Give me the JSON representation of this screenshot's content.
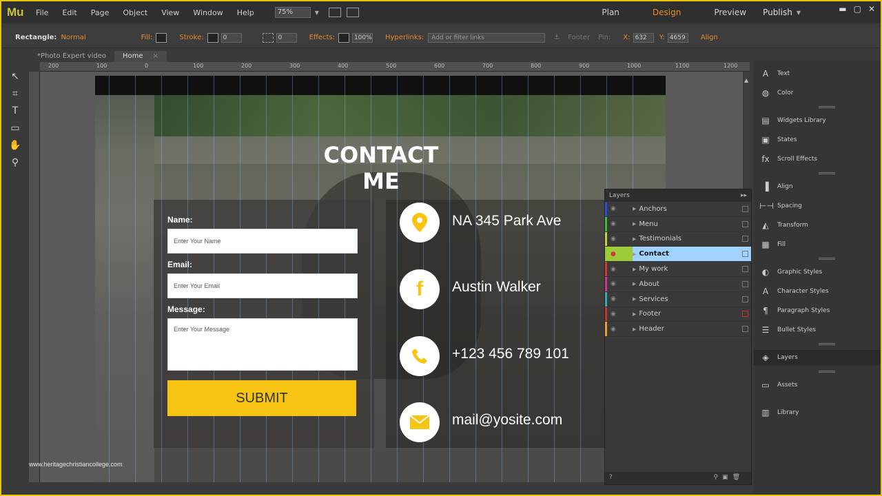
{
  "app": {
    "logo": "Mu",
    "menu": [
      "File",
      "Edit",
      "Page",
      "Object",
      "View",
      "Window",
      "Help"
    ],
    "zoom": "75%",
    "modes": [
      "Plan",
      "Design",
      "Preview"
    ],
    "active_mode": "Design",
    "publish": "Publish"
  },
  "control_bar": {
    "object_label": "Rectangle:",
    "object_state": "Normal",
    "fill_label": "Fill:",
    "stroke_label": "Stroke:",
    "stroke_value": "0",
    "corner_value": "0",
    "effects_label": "Effects:",
    "effects_value": "100%",
    "hyperlinks_label": "Hyperlinks:",
    "hyperlinks_placeholder": "Add or filter links",
    "footer_label": "Footer",
    "pin_label": "Pin:",
    "x_label": "X:",
    "x_value": "632",
    "y_label": "Y:",
    "y_value": "4659",
    "align_label": "Align"
  },
  "tabs": [
    {
      "label": "*Photo Expert video"
    },
    {
      "label": "Home"
    }
  ],
  "ruler_ticks": [
    "200",
    "100",
    "0",
    "100",
    "200",
    "300",
    "400",
    "500",
    "600",
    "700",
    "800",
    "900",
    "1000",
    "1100",
    "1200"
  ],
  "page": {
    "title": "CONTACT ME",
    "form": {
      "name_label": "Name:",
      "name_placeholder": "Enter Your Name",
      "email_label": "Email:",
      "email_placeholder": "Enter Your Email",
      "message_label": "Message:",
      "message_placeholder": "Enter Your Message",
      "submit": "SUBMIT"
    },
    "contacts": [
      {
        "icon": "location-pin-icon",
        "text": "NA 345 Park Ave"
      },
      {
        "icon": "facebook-icon",
        "text": "Austin Walker"
      },
      {
        "icon": "phone-icon",
        "text": "+123 456 789 101"
      },
      {
        "icon": "mail-icon",
        "text": "mail@yosite.com"
      }
    ],
    "accent": "#f7c414"
  },
  "layers_panel": {
    "title": "Layers",
    "items": [
      {
        "name": "Anchors",
        "color": "#2b4de0"
      },
      {
        "name": "Menu",
        "color": "#3bbf3b"
      },
      {
        "name": "Testimonials",
        "color": "#c8d23a"
      },
      {
        "name": "Contact",
        "color": "#9ccc3a",
        "selected": true
      },
      {
        "name": "My work",
        "color": "#d23a3a"
      },
      {
        "name": "About",
        "color": "#d2338e"
      },
      {
        "name": "Services",
        "color": "#2fb0b0"
      },
      {
        "name": "Footer",
        "color": "#c83232"
      },
      {
        "name": "Header",
        "color": "#e8a030"
      }
    ]
  },
  "right_panels": [
    "Text",
    "Color",
    "Widgets Library",
    "States",
    "Scroll Effects",
    "Align",
    "Spacing",
    "Transform",
    "Fill",
    "Graphic Styles",
    "Character Styles",
    "Paragraph Styles",
    "Bullet Styles",
    "Layers",
    "Assets",
    "Library"
  ],
  "watermark": "www.heritagechristiancollege.com"
}
